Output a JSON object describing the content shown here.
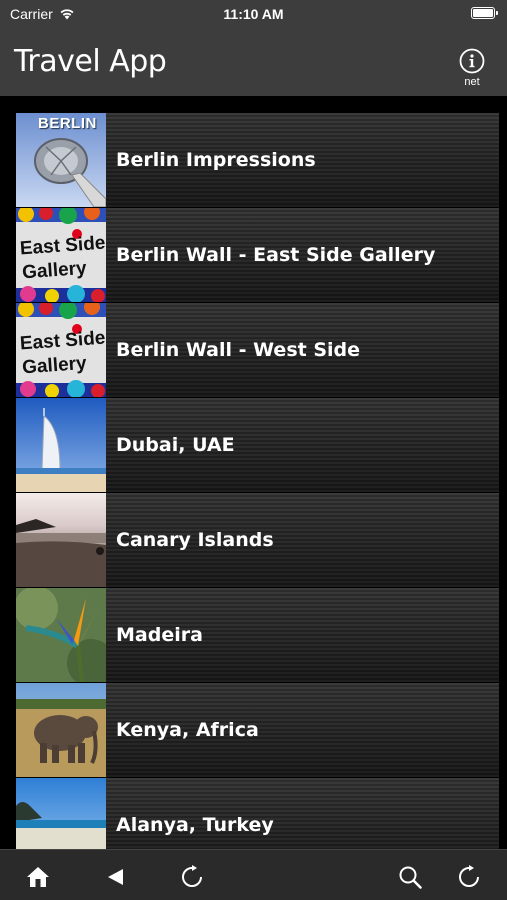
{
  "status_bar": {
    "carrier": "Carrier",
    "time": "11:10 AM"
  },
  "nav": {
    "title": "Travel App",
    "info_label": "net"
  },
  "destinations": [
    {
      "label": "Berlin Impressions",
      "thumb_text": "BERLIN"
    },
    {
      "label": "Berlin Wall - East Side Gallery",
      "thumb_text": [
        "East Side",
        "Gallery"
      ]
    },
    {
      "label": "Berlin Wall - West Side",
      "thumb_text": [
        "East Side",
        "Gallery"
      ]
    },
    {
      "label": "Dubai, UAE"
    },
    {
      "label": "Canary Islands"
    },
    {
      "label": "Madeira"
    },
    {
      "label": "Kenya, Africa"
    },
    {
      "label": "Alanya, Turkey"
    }
  ],
  "toolbar": {
    "icons": [
      "home-icon",
      "back-icon",
      "reload-icon",
      "search-icon",
      "refresh-icon"
    ]
  },
  "colors": {
    "bar_background": "#3d3d3d",
    "list_background": "#000000",
    "text": "#ffffff"
  }
}
